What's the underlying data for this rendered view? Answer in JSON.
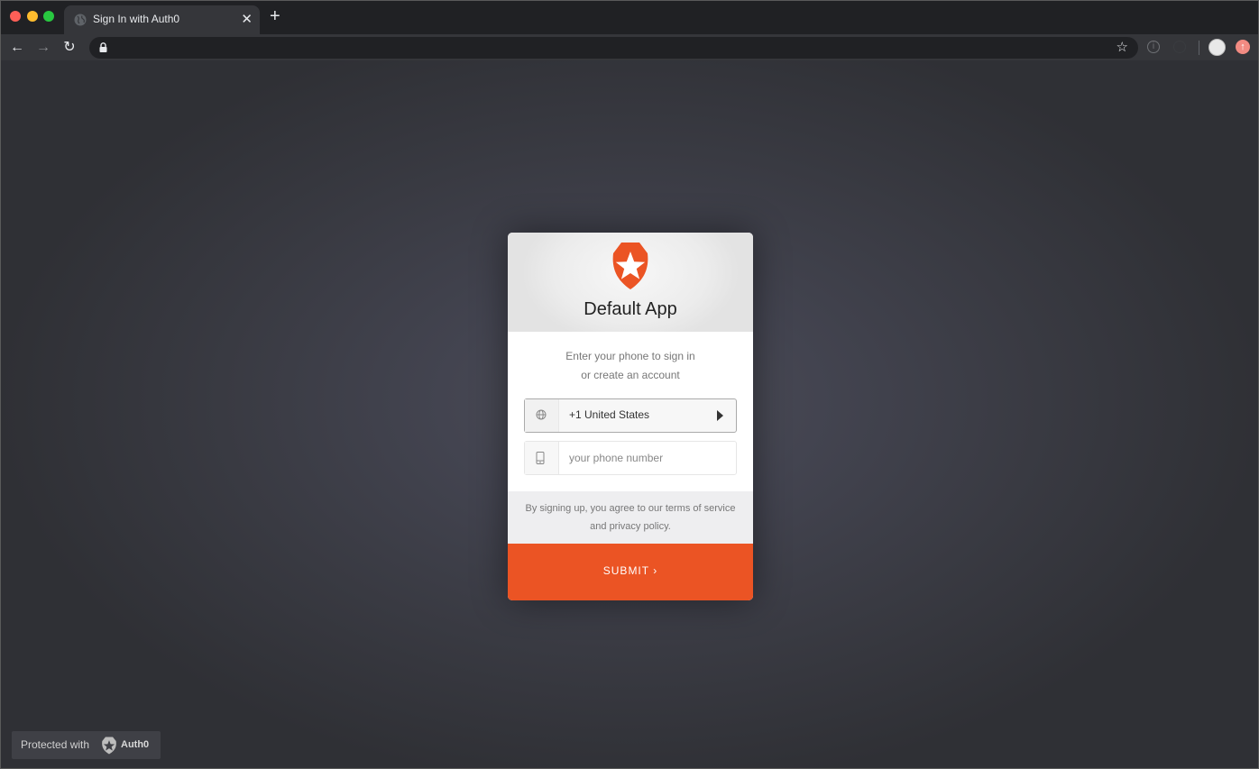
{
  "browser": {
    "tab_title": "Sign In with Auth0",
    "tab_close": "✕",
    "new_tab": "+",
    "back": "←",
    "forward": "→",
    "reload": "↻",
    "star": "☆",
    "info_icon": "i",
    "update_icon": "↑"
  },
  "card": {
    "app_title": "Default App",
    "intro_line1": "Enter your phone to sign in",
    "intro_line2": "or create an account",
    "country": "+1 United States",
    "phone_placeholder": "your phone number",
    "terms_line1": "By signing up, you agree to our terms of service",
    "terms_line2": "and privacy policy.",
    "submit_label": "SUBMIT ›",
    "accent_color": "#eb5424"
  },
  "badge": {
    "text": "Protected with",
    "brand": "Auth0"
  }
}
